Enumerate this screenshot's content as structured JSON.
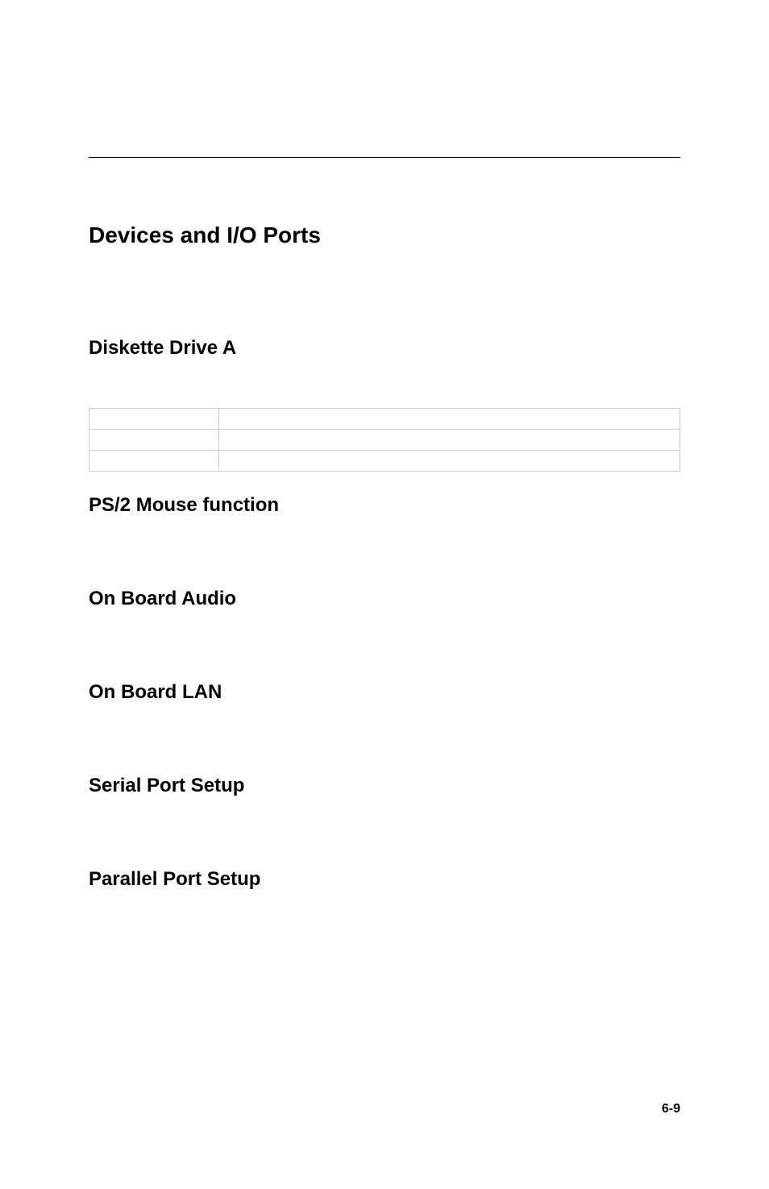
{
  "headings": {
    "main": "Devices and I/O Ports",
    "diskette": "Diskette Drive A",
    "ps2": "PS/2 Mouse function",
    "audio": "On Board Audio",
    "lan": "On Board LAN",
    "serial": "Serial Port Setup",
    "parallel": "Parallel Port Setup"
  },
  "table": {
    "rows": [
      {
        "c1": "",
        "c2": ""
      },
      {
        "c1": "",
        "c2": ""
      },
      {
        "c1": "",
        "c2": ""
      }
    ]
  },
  "page_number": "6-9"
}
